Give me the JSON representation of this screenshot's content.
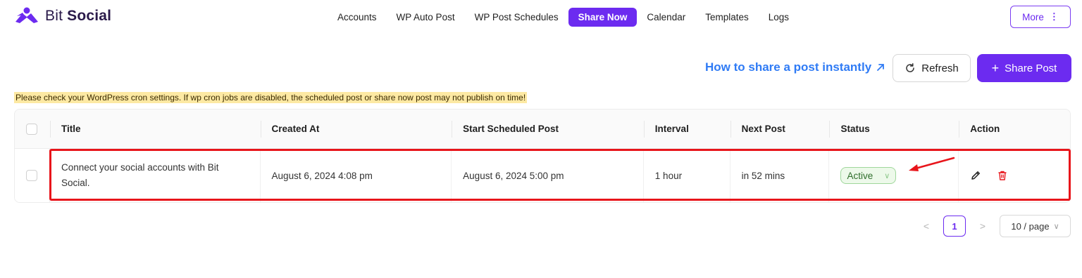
{
  "brand": {
    "name_light": "Bit",
    "name_bold": "Social",
    "color": "#6c2bf0"
  },
  "nav": [
    {
      "label": "Accounts",
      "active": false
    },
    {
      "label": "WP Auto Post",
      "active": false
    },
    {
      "label": "WP Post Schedules",
      "active": false
    },
    {
      "label": "Share Now",
      "active": true
    },
    {
      "label": "Calendar",
      "active": false
    },
    {
      "label": "Templates",
      "active": false
    },
    {
      "label": "Logs",
      "active": false
    }
  ],
  "more_label": "More",
  "toolbar": {
    "howto_label": "How to share a post instantly",
    "refresh_label": "Refresh",
    "share_label": "Share Post"
  },
  "warning": "Please check your WordPress cron settings. If wp cron jobs are disabled, the scheduled post or share now post may not publish on time!",
  "table": {
    "headers": [
      "Title",
      "Created At",
      "Start Scheduled Post",
      "Interval",
      "Next Post",
      "Status",
      "Action"
    ],
    "rows": [
      {
        "title": "Connect your social accounts with Bit Social.",
        "created_at": "August 6, 2024 4:08 pm",
        "start": "August 6, 2024 5:00 pm",
        "interval": "1 hour",
        "next_post": "in 52 mins",
        "status": "Active"
      }
    ]
  },
  "pagination": {
    "current_page": "1",
    "page_size": "10 / page"
  },
  "colors": {
    "accent": "#6c2bf0",
    "link": "#2f7bf5",
    "danger": "#e8151b",
    "active_status": "#2f6e2c"
  }
}
